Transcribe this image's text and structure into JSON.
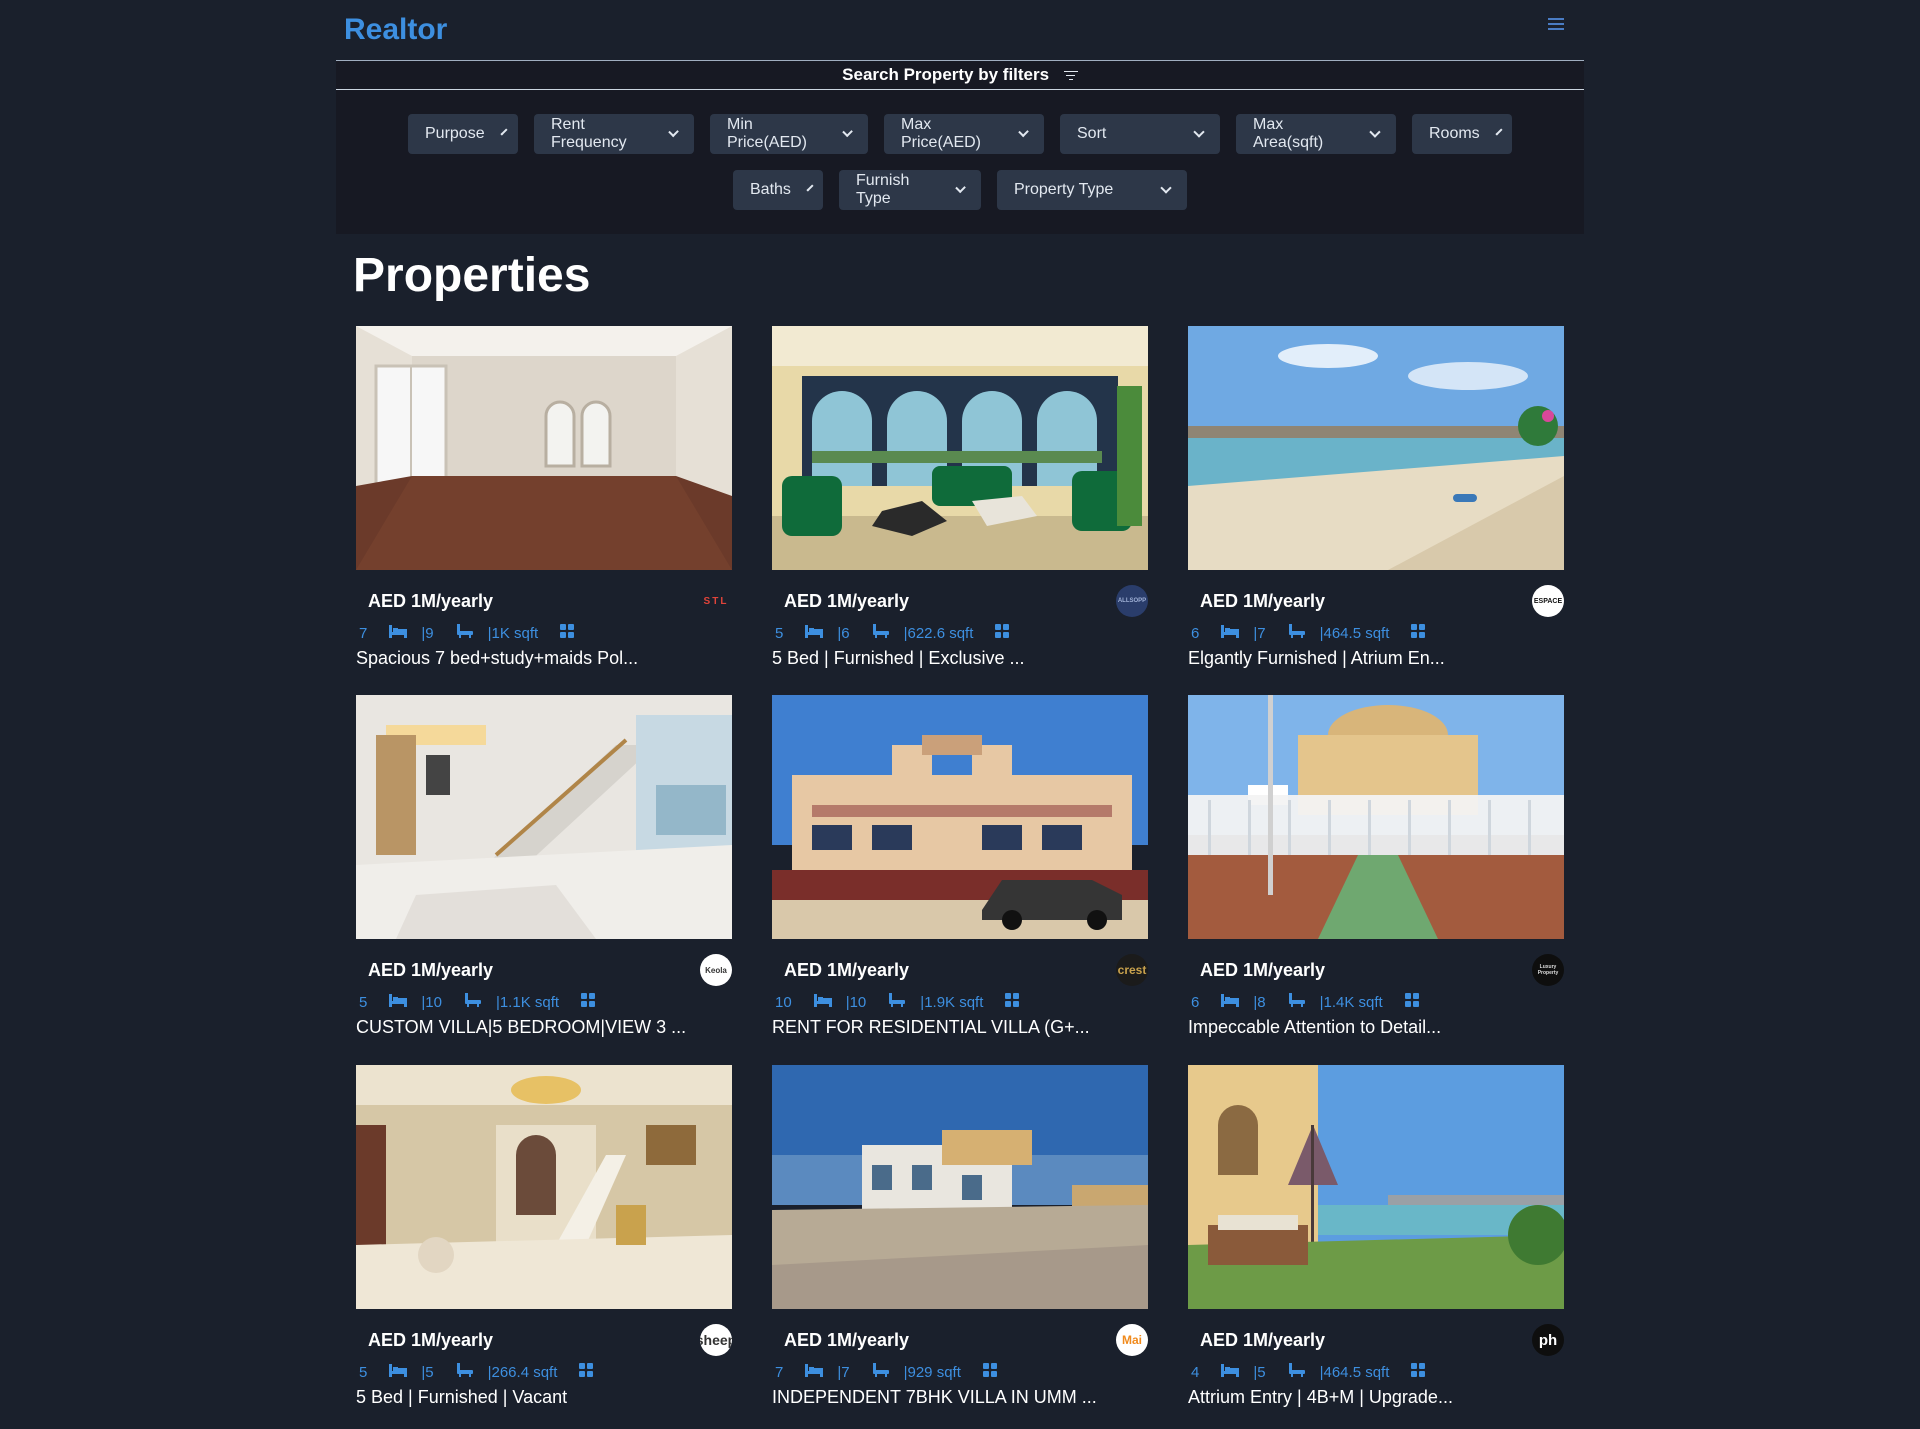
{
  "brand": "Realtor",
  "filters": {
    "title": "Search Property by filters",
    "row1": [
      "Purpose",
      "Rent Frequency",
      "Min Price(AED)",
      "Max Price(AED)",
      "Sort",
      "Max Area(sqft)",
      "Rooms"
    ],
    "row2": [
      "Baths",
      "Furnish Type",
      "Property Type"
    ]
  },
  "heading": "Properties",
  "listings": [
    {
      "price": "AED 1M/yearly",
      "rooms": "7",
      "baths": "9",
      "area": "1K sqft",
      "title": "Spacious 7 bed+study+maids Pol...",
      "agency": "STL",
      "photo": "empty-villa-room"
    },
    {
      "price": "AED 1M/yearly",
      "rooms": "5",
      "baths": "6",
      "area": "622.6 sqft",
      "title": "5 Bed | Furnished | Exclusive ...",
      "agency": "ALLSOPP",
      "photo": "green-living-room"
    },
    {
      "price": "AED 1M/yearly",
      "rooms": "6",
      "baths": "7",
      "area": "464.5 sqft",
      "title": "Elgantly Furnished | Atrium En...",
      "agency": "ESPACE",
      "photo": "beach-shore"
    },
    {
      "price": "AED 1M/yearly",
      "rooms": "5",
      "baths": "10",
      "area": "1.1K sqft",
      "title": "CUSTOM VILLA|5 BEDROOM|VIEW 3 ...",
      "agency": "Keola",
      "photo": "marble-staircase"
    },
    {
      "price": "AED 1M/yearly",
      "rooms": "10",
      "baths": "10",
      "area": "1.9K sqft",
      "title": "RENT FOR RESIDENTIAL VILLA (G+...",
      "agency": "crest",
      "photo": "villa-exterior-car"
    },
    {
      "price": "AED 1M/yearly",
      "rooms": "6",
      "baths": "8",
      "area": "1.4K sqft",
      "title": "Impeccable Attention to Detail...",
      "agency": "Luxury Property",
      "photo": "villa-gate"
    },
    {
      "price": "AED 1M/yearly",
      "rooms": "5",
      "baths": "5",
      "area": "266.4 sqft",
      "title": "5 Bed | Furnished | Vacant",
      "agency": "sheep",
      "photo": "chandelier-hall"
    },
    {
      "price": "AED 1M/yearly",
      "rooms": "7",
      "baths": "7",
      "area": "929 sqft",
      "title": "INDEPENDENT 7BHK VILLA IN UMM ...",
      "agency": "Mai",
      "photo": "villa-courtyard"
    },
    {
      "price": "AED 1M/yearly",
      "rooms": "4",
      "baths": "5",
      "area": "464.5 sqft",
      "title": "Attrium Entry | 4B+M | Upgrade...",
      "agency": "ph",
      "photo": "terrace-sea"
    }
  ]
}
